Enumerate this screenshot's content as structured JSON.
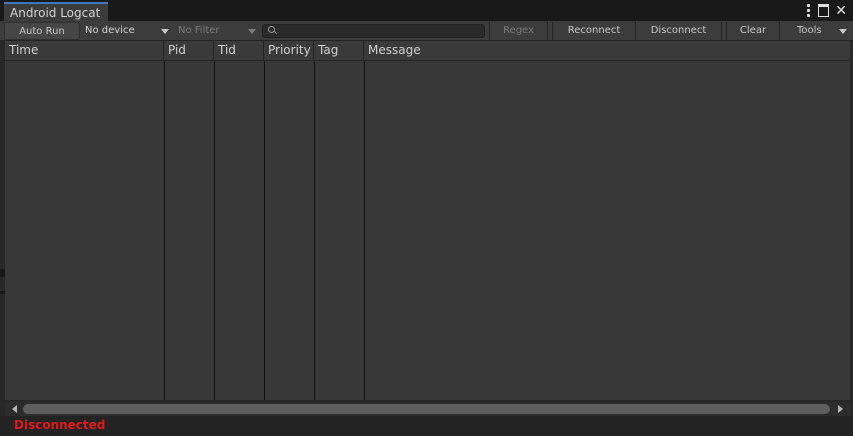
{
  "window": {
    "tab_title": "Android Logcat",
    "icons": [
      "menu-dots-icon",
      "maximize-icon",
      "close-icon"
    ]
  },
  "toolbar": {
    "auto_run_label": "Auto Run",
    "device_selected": "No device",
    "filter_selected": "No Filter",
    "search_placeholder": "",
    "regex_label": "Regex",
    "reconnect_label": "Reconnect",
    "disconnect_label": "Disconnect",
    "clear_label": "Clear",
    "tools_label": "Tools"
  },
  "table": {
    "columns": [
      {
        "label": "Time"
      },
      {
        "label": "Pid"
      },
      {
        "label": "Tid"
      },
      {
        "label": "Priority"
      },
      {
        "label": "Tag"
      },
      {
        "label": "Message"
      }
    ],
    "rows": []
  },
  "status": {
    "text": "Disconnected",
    "color": "#e21a1a"
  },
  "colors": {
    "accent": "#3a79bb",
    "panel": "#383838",
    "toolbar": "#3c3c3c"
  }
}
